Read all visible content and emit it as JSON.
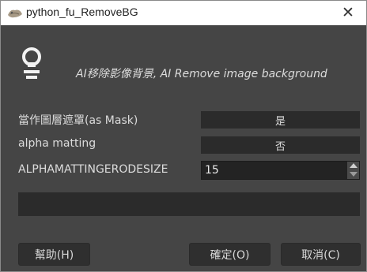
{
  "window": {
    "title": "python_fu_RemoveBG",
    "close_glyph": "✕",
    "icon_name": "gimp-icon"
  },
  "header": {
    "icon_name": "lightbulb-icon",
    "description": "AI移除影像背景, AI Remove image background"
  },
  "form": {
    "rows": [
      {
        "label": "當作圖層遮罩(as Mask)",
        "value": "是"
      },
      {
        "label": "alpha matting",
        "value": "否"
      },
      {
        "label": "ALPHAMATTINGERODESIZE",
        "value": "15"
      }
    ]
  },
  "buttons": {
    "help": "幫助(H)",
    "ok": "確定(O)",
    "cancel": "取消(C)"
  },
  "colors": {
    "dialog_bg": "#454545",
    "field_bg": "#2b2b2b",
    "text": "#dcdcdc"
  }
}
